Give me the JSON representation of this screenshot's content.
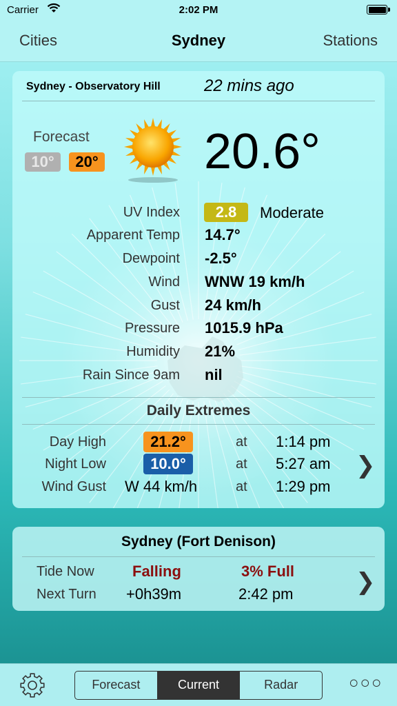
{
  "status_bar": {
    "carrier": "Carrier",
    "time": "2:02 PM"
  },
  "nav": {
    "left": "Cities",
    "title": "Sydney",
    "right": "Stations"
  },
  "station": {
    "name": "Sydney - Observatory Hill",
    "updated": "22 mins ago",
    "forecast_label": "Forecast",
    "forecast_low": "10°",
    "forecast_high": "20°",
    "condition_icon": "sun-icon",
    "temperature": "20.6°"
  },
  "observations": [
    {
      "label": "UV Index",
      "value": "2.8",
      "extra": "Moderate"
    },
    {
      "label": "Apparent Temp",
      "value": "14.7°"
    },
    {
      "label": "Dewpoint",
      "value": "-2.5°"
    },
    {
      "label": "Wind",
      "value": "WNW 19 km/h"
    },
    {
      "label": "Gust",
      "value": "24 km/h"
    },
    {
      "label": "Pressure",
      "value": "1015.9 hPa"
    },
    {
      "label": "Humidity",
      "value": "21%"
    },
    {
      "label": "Rain Since 9am",
      "value": "nil"
    }
  ],
  "extremes": {
    "title": "Daily Extremes",
    "rows": [
      {
        "label": "Day High",
        "value": "21.2°",
        "at": "at",
        "time": "1:14 pm"
      },
      {
        "label": "Night Low",
        "value": "10.0°",
        "at": "at",
        "time": "5:27 am"
      },
      {
        "label": "Wind Gust",
        "value": "W 44 km/h",
        "at": "at",
        "time": "1:29 pm"
      }
    ],
    "chevron": "❯"
  },
  "tide": {
    "title": "Sydney (Fort Denison)",
    "now_label": "Tide Now",
    "now_state": "Falling",
    "now_level": "3% Full",
    "next_label": "Next Turn",
    "next_in": "+0h39m",
    "next_time": "2:42 pm",
    "chevron": "❯"
  },
  "bottom": {
    "tabs": [
      "Forecast",
      "Current",
      "Radar"
    ],
    "active_tab": "Current",
    "more": "○○○"
  },
  "colors": {
    "forecast_high": "#f7931e",
    "forecast_low": "#b0b0b0",
    "uv_moderate": "#c4b816",
    "day_high": "#f7931e",
    "night_low": "#1a5ea8",
    "tide_text": "#8b0f0f"
  }
}
